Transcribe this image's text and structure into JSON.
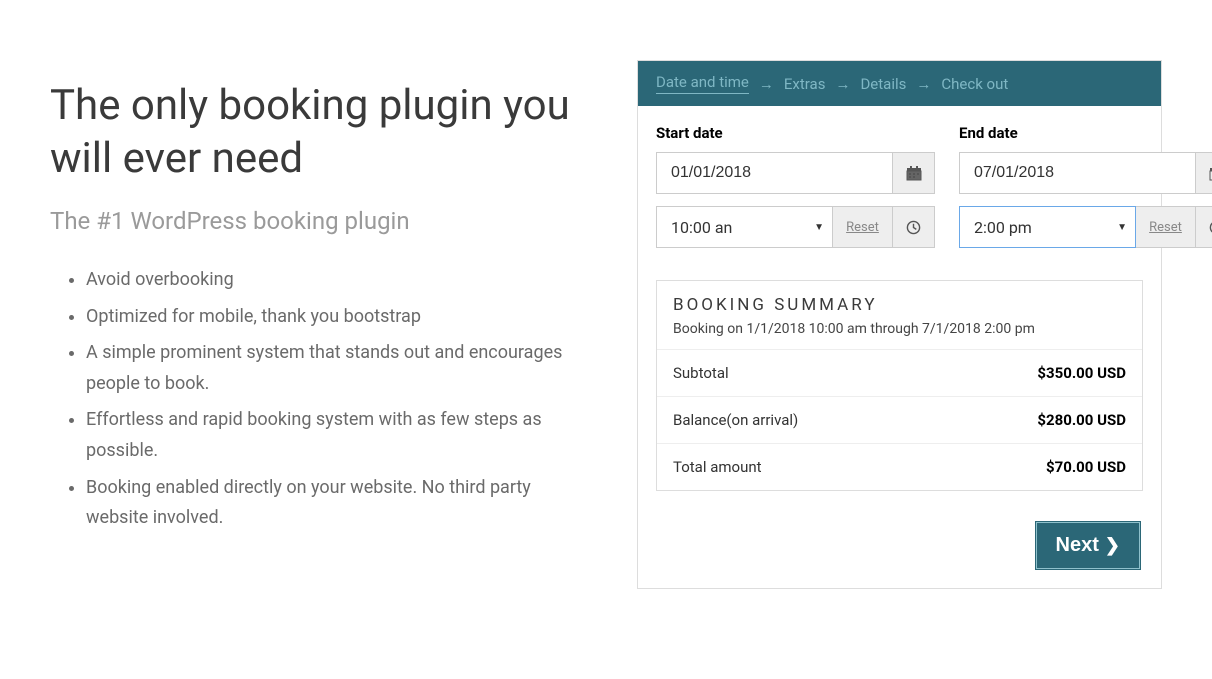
{
  "hero": {
    "title": "The only booking plugin you will ever need",
    "subtitle": "The #1 WordPress booking plugin",
    "bullets": [
      "Avoid overbooking",
      "Optimized for mobile, thank you bootstrap",
      "A simple prominent system that stands out and encourages people to book.",
      "Effortless and rapid booking system with as few steps as possible.",
      "Booking enabled directly on your website. No third party website involved."
    ]
  },
  "widget": {
    "steps": [
      "Date and time",
      "Extras",
      "Details",
      "Check out"
    ],
    "active_step": 0,
    "start": {
      "label": "Start date",
      "date": "01/01/2018",
      "time": "10:00 an",
      "reset": "Reset"
    },
    "end": {
      "label": "End date",
      "date": "07/01/2018",
      "time": "2:00 pm",
      "reset": "Reset"
    },
    "summary": {
      "title": "BOOKING SUMMARY",
      "subtitle": "Booking on 1/1/2018 10:00 am through 7/1/2018 2:00 pm",
      "rows": [
        {
          "label": "Subtotal",
          "value": "$350.00 USD"
        },
        {
          "label": "Balance(on arrival)",
          "value": "$280.00 USD"
        },
        {
          "label": "Total amount",
          "value": "$70.00 USD"
        }
      ]
    },
    "next_label": "Next"
  }
}
